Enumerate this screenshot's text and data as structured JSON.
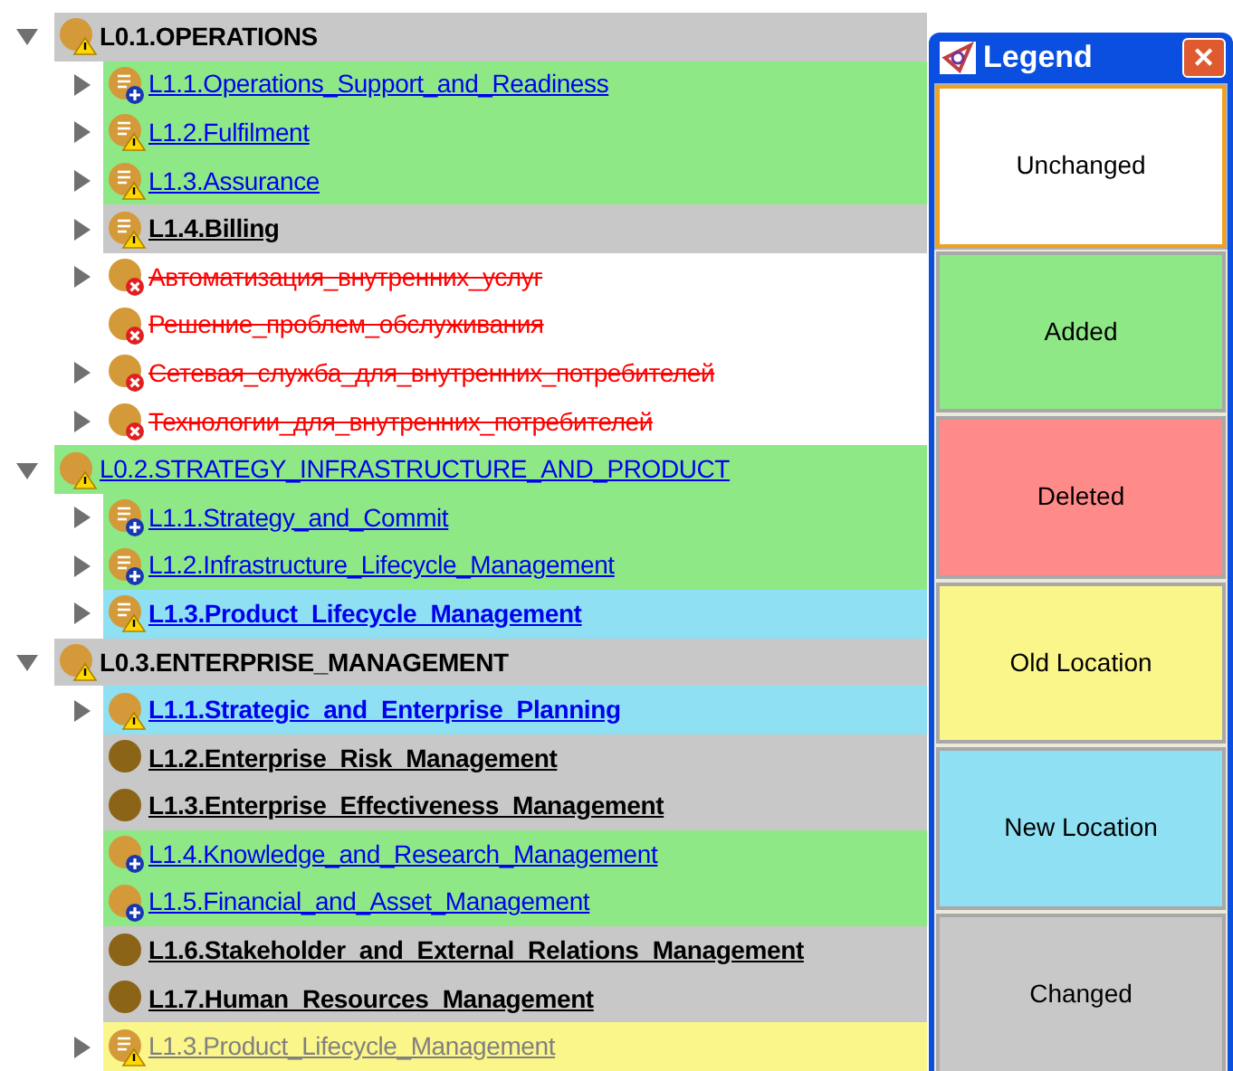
{
  "tree": [
    {
      "label": "L0.1.OPERATIONS",
      "kind": "changed",
      "expanded": true,
      "leaf": false,
      "documented": false,
      "warning": true,
      "link": false,
      "children": [
        {
          "label": "L1.1.Operations_Support_and_Readiness",
          "kind": "added",
          "leaf": false,
          "documented": true,
          "warning": false,
          "link": true
        },
        {
          "label": "L1.2.Fulfilment",
          "kind": "added",
          "leaf": false,
          "documented": true,
          "warning": true,
          "link": true
        },
        {
          "label": "L1.3.Assurance",
          "kind": "added",
          "leaf": false,
          "documented": true,
          "warning": true,
          "link": true
        },
        {
          "label": "L1.4.Billing",
          "kind": "changed",
          "leaf": false,
          "documented": true,
          "warning": true,
          "link": true
        },
        {
          "label": "Автоматизация_внутренних_услуг",
          "kind": "deleted",
          "leaf": false,
          "documented": false,
          "warning": false,
          "link": false
        },
        {
          "label": "Решение_проблем_обслуживания",
          "kind": "deleted",
          "leaf": true,
          "documented": false,
          "warning": false,
          "link": false
        },
        {
          "label": "Сетевая_служба_для_внутренних_потребителей",
          "kind": "deleted",
          "leaf": false,
          "documented": false,
          "warning": false,
          "link": false
        },
        {
          "label": "Технологии_для_внутренних_потребителей",
          "kind": "deleted",
          "leaf": false,
          "documented": false,
          "warning": false,
          "link": false
        }
      ]
    },
    {
      "label": "L0.2.STRATEGY_INFRASTRUCTURE_AND_PRODUCT",
      "kind": "added",
      "expanded": true,
      "leaf": false,
      "documented": false,
      "warning": true,
      "link": true,
      "children": [
        {
          "label": "L1.1.Strategy_and_Commit",
          "kind": "added",
          "leaf": false,
          "documented": true,
          "warning": false,
          "link": true
        },
        {
          "label": "L1.2.Infrastructure_Lifecycle_Management",
          "kind": "added",
          "leaf": false,
          "documented": true,
          "warning": false,
          "link": true
        },
        {
          "label": "L1.3.Product_Lifecycle_Management",
          "kind": "new",
          "leaf": false,
          "documented": true,
          "warning": true,
          "link": true
        }
      ]
    },
    {
      "label": "L0.3.ENTERPRISE_MANAGEMENT",
      "kind": "changed",
      "expanded": true,
      "leaf": false,
      "documented": false,
      "warning": true,
      "link": false,
      "children": [
        {
          "label": "L1.1.Strategic_and_Enterprise_Planning",
          "kind": "new",
          "leaf": false,
          "documented": false,
          "warning": true,
          "link": true
        },
        {
          "label": "L1.2.Enterprise_Risk_Management",
          "kind": "changed",
          "leaf": true,
          "documented": false,
          "warning": false,
          "link": true
        },
        {
          "label": "L1.3.Enterprise_Effectiveness_Management",
          "kind": "changed",
          "leaf": true,
          "documented": false,
          "warning": false,
          "link": true
        },
        {
          "label": "L1.4.Knowledge_and_Research_Management",
          "kind": "added",
          "leaf": true,
          "documented": false,
          "warning": false,
          "link": true
        },
        {
          "label": "L1.5.Financial_and_Asset_Management",
          "kind": "added",
          "leaf": true,
          "documented": false,
          "warning": false,
          "link": true
        },
        {
          "label": "L1.6.Stakeholder_and_External_Relations_Management",
          "kind": "changed",
          "leaf": true,
          "documented": false,
          "warning": false,
          "link": true
        },
        {
          "label": "L1.7.Human_Resources_Management",
          "kind": "changed",
          "leaf": true,
          "documented": false,
          "warning": false,
          "link": true
        },
        {
          "label": "L1.3.Product_Lifecycle_Management",
          "kind": "old",
          "leaf": false,
          "documented": true,
          "warning": true,
          "link": true
        }
      ]
    }
  ],
  "legend": {
    "title": "Legend",
    "close": "✕",
    "items": [
      {
        "label": "Unchanged",
        "color": "#ffffff",
        "selected": true
      },
      {
        "label": "Added",
        "color": "#8ee886",
        "selected": false
      },
      {
        "label": "Deleted",
        "color": "#ff8a8a",
        "selected": false
      },
      {
        "label": "Old Location",
        "color": "#fbf68a",
        "selected": false
      },
      {
        "label": "New Location",
        "color": "#8ee0f2",
        "selected": false
      },
      {
        "label": "Changed",
        "color": "#c8c8c8",
        "selected": false
      }
    ]
  }
}
